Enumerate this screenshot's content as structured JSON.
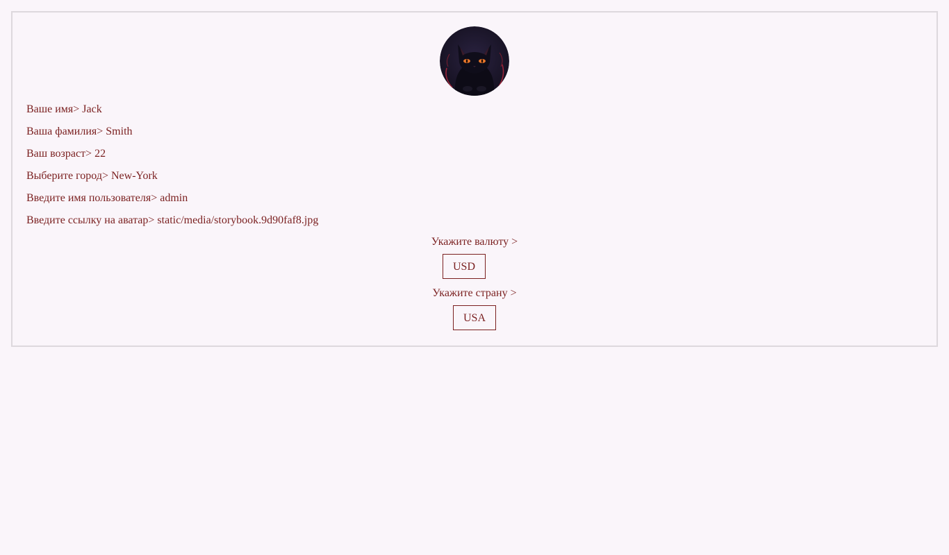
{
  "profile": {
    "avatar_icon": "black-cat-avatar-icon",
    "fields": [
      {
        "label": "Ваше имя>",
        "value": "Jack"
      },
      {
        "label": "Ваша фамилия>",
        "value": "Smith"
      },
      {
        "label": "Ваш возраст>",
        "value": "22"
      },
      {
        "label": "Выберите город>",
        "value": "New-York"
      },
      {
        "label": "Введите имя пользователя>",
        "value": "admin"
      },
      {
        "label": "Введите ссылку на аватар>",
        "value": "static/media/storybook.9d90faf8.jpg"
      }
    ]
  },
  "currency": {
    "label": "Укажите валюту >",
    "value": "USD"
  },
  "country": {
    "label": "Укажите страну >",
    "value": "USA"
  },
  "colors": {
    "text": "#7a1f1f",
    "background": "#faf5fa",
    "border": "#ddd8dd"
  }
}
